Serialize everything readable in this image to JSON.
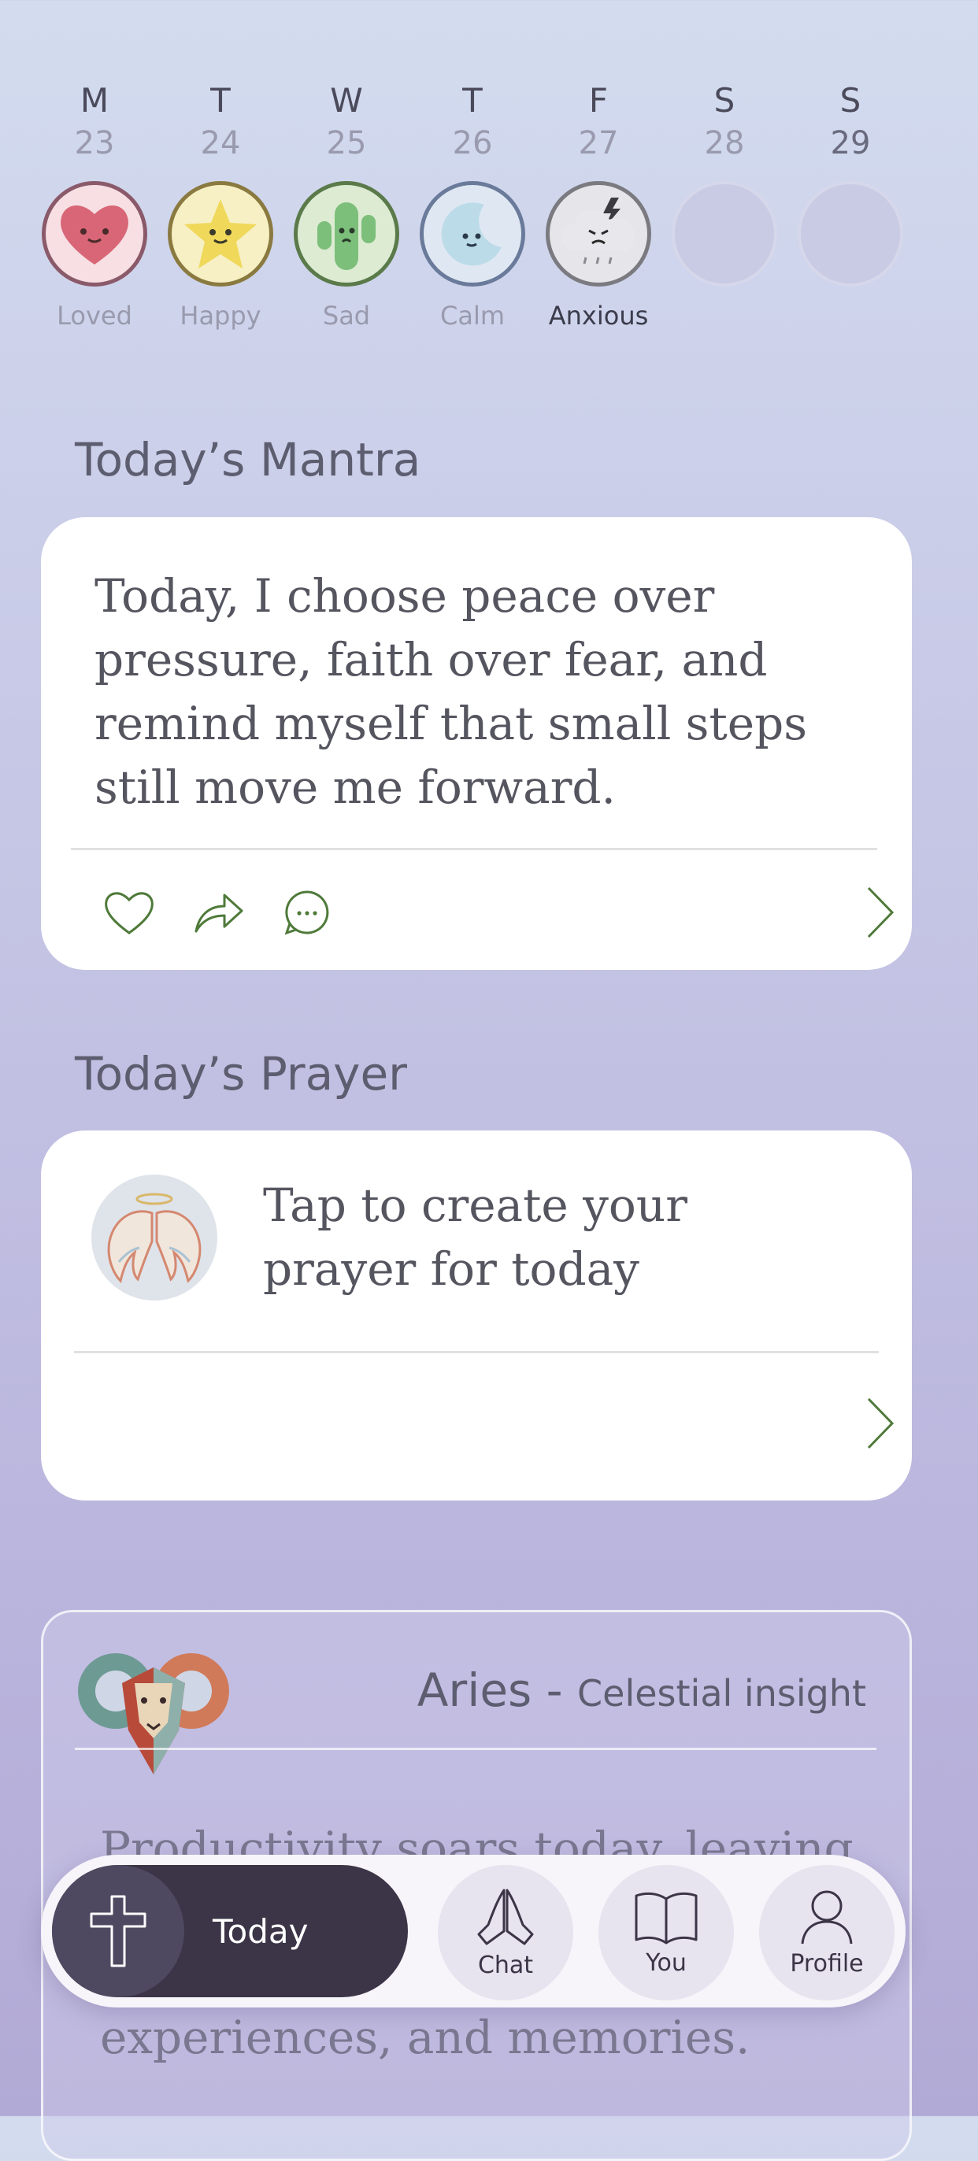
{
  "week": [
    {
      "letter": "M",
      "date": "23",
      "mood": "Loved",
      "icon": "heart-face-icon",
      "color": "#8a5a6a"
    },
    {
      "letter": "T",
      "date": "24",
      "mood": "Happy",
      "icon": "star-face-icon",
      "color": "#8a7a40"
    },
    {
      "letter": "W",
      "date": "25",
      "mood": "Sad",
      "icon": "cactus-face-icon",
      "color": "#5a7a4a"
    },
    {
      "letter": "T",
      "date": "26",
      "mood": "Calm",
      "icon": "moon-face-icon",
      "color": "#6a7a9a"
    },
    {
      "letter": "F",
      "date": "27",
      "mood": "Anxious",
      "icon": "storm-cloud-face-icon",
      "color": "#7a7a80"
    },
    {
      "letter": "S",
      "date": "28",
      "mood": "",
      "icon": "",
      "color": ""
    },
    {
      "letter": "S",
      "date": "29",
      "mood": "",
      "icon": "",
      "color": ""
    }
  ],
  "mantra": {
    "title": "Today’s Mantra",
    "text": "Today, I choose peace over pressure, faith over fear, and remind myself that small steps still move me forward."
  },
  "prayer": {
    "title": "Today’s Prayer",
    "text": "Tap to create your prayer for today"
  },
  "celestial": {
    "sign": "Aries",
    "separator": " - ",
    "subtitle": "Celestial insight",
    "text": "Productivity soars today, leaving room for new connections, experiences, and memories."
  },
  "nav": {
    "today": "Today",
    "chat": "Chat",
    "you": "You",
    "profile": "Profile"
  },
  "colors": {
    "accent_green": "#4f7a3a",
    "nav_dark": "#3b3547"
  }
}
